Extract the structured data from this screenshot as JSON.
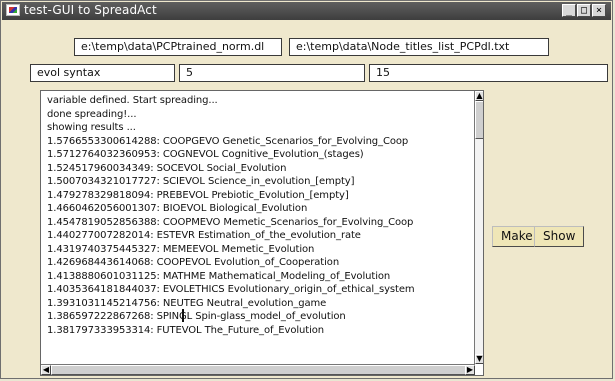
{
  "window": {
    "title": "test-GUI to SpreadAct",
    "controls": {
      "minimize": "_",
      "maximize": "□",
      "close": "×"
    }
  },
  "files": {
    "model_path": "e:\\temp\\data\\PCPtrained_norm.dl",
    "titles_path": "e:\\temp\\data\\Node_titles_list_PCPdl.txt"
  },
  "inputs": {
    "query": "evol syntax",
    "param_a": "5",
    "param_b": "15"
  },
  "output": {
    "lines": [
      "variable defined. Start spreading...",
      "done spreading!...",
      "showing results ...",
      "1.5766553300614288: COOPGEVO Genetic_Scenarios_for_Evolving_Coop",
      "1.5712764032360953: COGNEVOL Cognitive_Evolution_(stages)",
      "1.524517960034349: SOCEVOL Social_Evolution",
      "1.5007034321017727: SCIEVOL Science_in_evolution_[empty]",
      "1.479278329818094: PREBEVOL Prebiotic_Evolution_[empty]",
      "1.4660462056001307: BIOEVOL Biological_Evolution",
      "1.4547819052856388: COOPMEVO Memetic_Scenarios_for_Evolving_Coop",
      "1.440277007282014: ESTEVR Estimation_of_the_evolution_rate",
      "1.4319740375445327: MEMEEVOL Memetic_Evolution",
      "1.426968443614068: COOPEVOL Evolution_of_Cooperation",
      "1.4138880601031125: MATHME Mathematical_Modeling_of_Evolution",
      "1.4035364181844037: EVOLETHICS Evolutionary_origin_of_ethical_system",
      "1.3931031145214756: NEUTEG Neutral_evolution_game",
      "1.386597222867268: SPINGL Spin-glass_model_of_evolution",
      "1.381797333953314: FUTEVOL The_Future_of_Evolution"
    ]
  },
  "buttons": {
    "make": "Make",
    "show": "Show"
  },
  "scrollbar_glyphs": {
    "up": "▲",
    "down": "▼",
    "left": "◀",
    "right": "▶"
  }
}
